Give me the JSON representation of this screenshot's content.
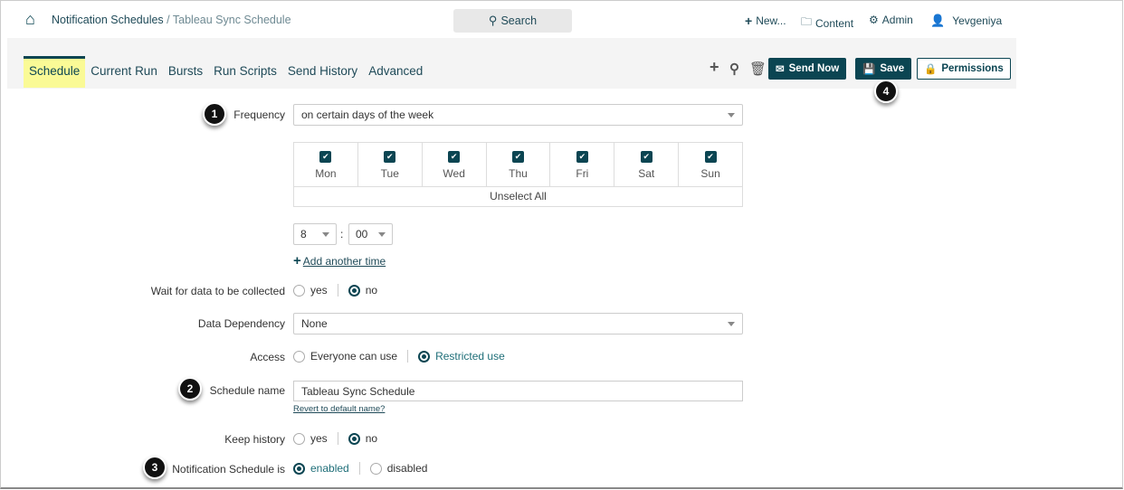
{
  "header": {
    "breadcrumb_root": "Notification Schedules",
    "breadcrumb_sep": " / ",
    "breadcrumb_current": "Tableau Sync Schedule",
    "search_label": "Search",
    "new_label": "New...",
    "content_label": "Content",
    "admin_label": "Admin",
    "user_label": "Yevgeniya"
  },
  "tabs": [
    "Schedule",
    "Current Run",
    "Bursts",
    "Run Scripts",
    "Send History",
    "Advanced"
  ],
  "toolbar": {
    "send_now": "Send Now",
    "save": "Save",
    "permissions": "Permissions"
  },
  "badges": [
    "1",
    "2",
    "3",
    "4"
  ],
  "form": {
    "frequency_label": "Frequency",
    "frequency_value": "on certain days of the week",
    "days": [
      "Mon",
      "Tue",
      "Wed",
      "Thu",
      "Fri",
      "Sat",
      "Sun"
    ],
    "unselect_all": "Unselect All",
    "hour": "8",
    "colon": ":",
    "minute": "00",
    "add_time": "Add another time",
    "wait_label": "Wait for data to be collected",
    "yes": "yes",
    "no": "no",
    "dependency_label": "Data Dependency",
    "dependency_value": "None",
    "access_label": "Access",
    "access_everyone": "Everyone can use",
    "access_restricted": "Restricted use",
    "name_label": "Schedule name",
    "name_value": "Tableau Sync Schedule",
    "revert": "Revert to default name?",
    "history_label": "Keep history",
    "status_label": "Notification Schedule is",
    "enabled": "enabled",
    "disabled": "disabled"
  }
}
